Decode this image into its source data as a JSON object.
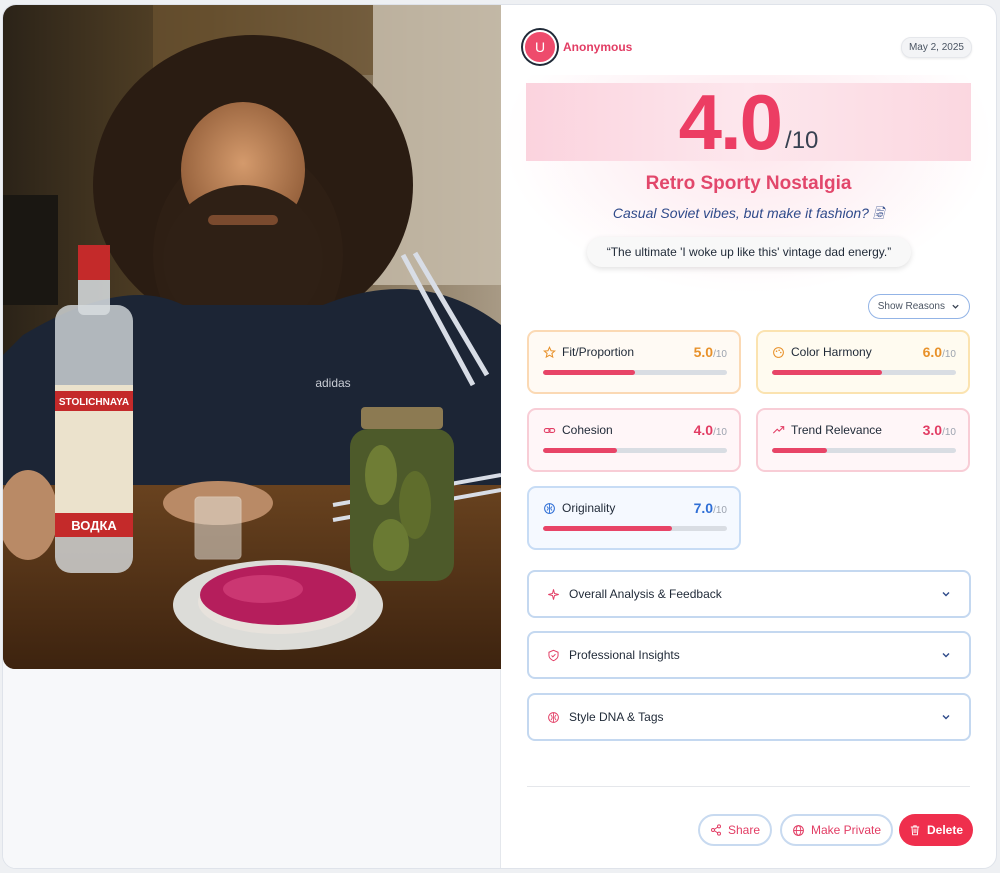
{
  "user": {
    "avatar_letter": "U",
    "name": "Anonymous"
  },
  "date": "May 2, 2025",
  "score": {
    "value": "4.0",
    "max": "/10"
  },
  "style_title": "Retro Sporty Nostalgia",
  "subtitle": "Casual Soviet vibes, but make it fashion? 🗟",
  "quote": "“The ultimate 'I woke up like this' vintage dad energy.”",
  "show_reasons": "Show Reasons",
  "metrics": [
    {
      "name": "Fit/Proportion",
      "score": "5.0",
      "max": "/10",
      "fill": 0.5,
      "icon": "star-icon",
      "color": "#e8912a"
    },
    {
      "name": "Color Harmony",
      "score": "6.0",
      "max": "/10",
      "fill": 0.6,
      "icon": "palette-icon",
      "color": "#e8912a"
    },
    {
      "name": "Cohesion",
      "score": "4.0",
      "max": "/10",
      "fill": 0.4,
      "icon": "link-icon",
      "color": "#e23d64"
    },
    {
      "name": "Trend Relevance",
      "score": "3.0",
      "max": "/10",
      "fill": 0.3,
      "icon": "trending-up-icon",
      "color": "#e23d64"
    },
    {
      "name": "Originality",
      "score": "7.0",
      "max": "/10",
      "fill": 0.7,
      "icon": "lightbulb-icon",
      "color": "#2f6fd6"
    }
  ],
  "sections": [
    {
      "label": "Overall Analysis & Feedback",
      "icon": "sparkles-icon"
    },
    {
      "label": "Professional Insights",
      "icon": "shield-icon"
    },
    {
      "label": "Style DNA & Tags",
      "icon": "dna-icon"
    }
  ],
  "actions": {
    "share": "Share",
    "make_private": "Make Private",
    "delete": "Delete"
  },
  "photo_labels": {
    "adidas": "adidas",
    "stolichnaya": "STOLICHNAYA",
    "vodka": "ВОДКА"
  },
  "colors": {
    "accent": "#e84467",
    "delete": "#ef2f4d"
  }
}
